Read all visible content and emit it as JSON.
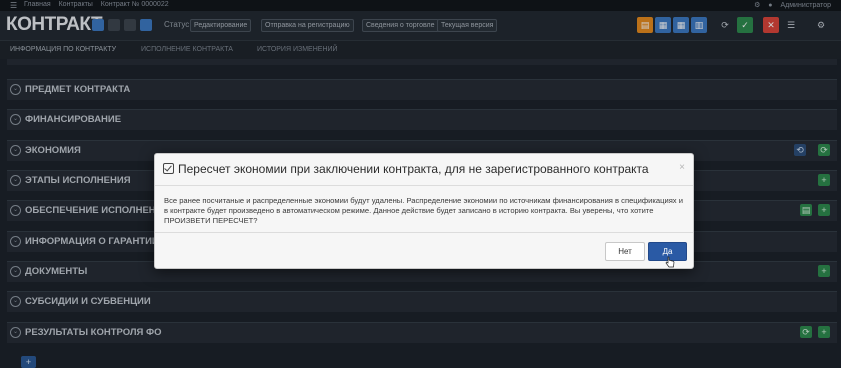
{
  "topbar": {
    "menu_icon": "☰",
    "crumbs": [
      "Главная",
      "Контракты",
      "Контракт № 0000022"
    ],
    "right": [
      "⚙",
      "●",
      "Администратор"
    ]
  },
  "header": {
    "title": "КОНТРАКТ",
    "toolbar_label": "Статус:",
    "tool_buttons": [
      "Редактирование",
      "Отправка на регистрацию",
      "Сведения о торговле",
      "Текущая версия"
    ]
  },
  "tabs": [
    "Информация по контракту",
    "Исполнение контракта",
    "История изменений"
  ],
  "sections": [
    {
      "label": "Предмет контракта"
    },
    {
      "label": "Финансирование"
    },
    {
      "label": "Экономия"
    },
    {
      "label": "Этапы исполнения"
    },
    {
      "label": "Обеспечение исполнения"
    },
    {
      "label": "Информация о гарантии"
    },
    {
      "label": "Документы"
    },
    {
      "label": "Субсидии и субвенции"
    },
    {
      "label": "Результаты контроля ФО"
    }
  ],
  "modal": {
    "title": "Пересчет экономии при заключении контракта, для не зарегистрованного контракта",
    "body": "Все ранее посчитаные и распределенные экономии будут удалены. Распределение экономии по источникам финансирования в спецификациях и в контракте будет произведено в автоматическом режиме. Данное действие будет записано в историю контракта. Вы уверены, что хотите ПРОИЗВЕТИ ПЕРЕСЧЕТ?",
    "no_label": "Нет",
    "yes_label": "Да",
    "close_symbol": "×"
  },
  "bottom_button": "+",
  "colors": {
    "accent_blue": "#2a5aa5",
    "accent_green": "#2e8a4f",
    "accent_orange": "#e58a1f",
    "accent_red": "#d9453b"
  }
}
